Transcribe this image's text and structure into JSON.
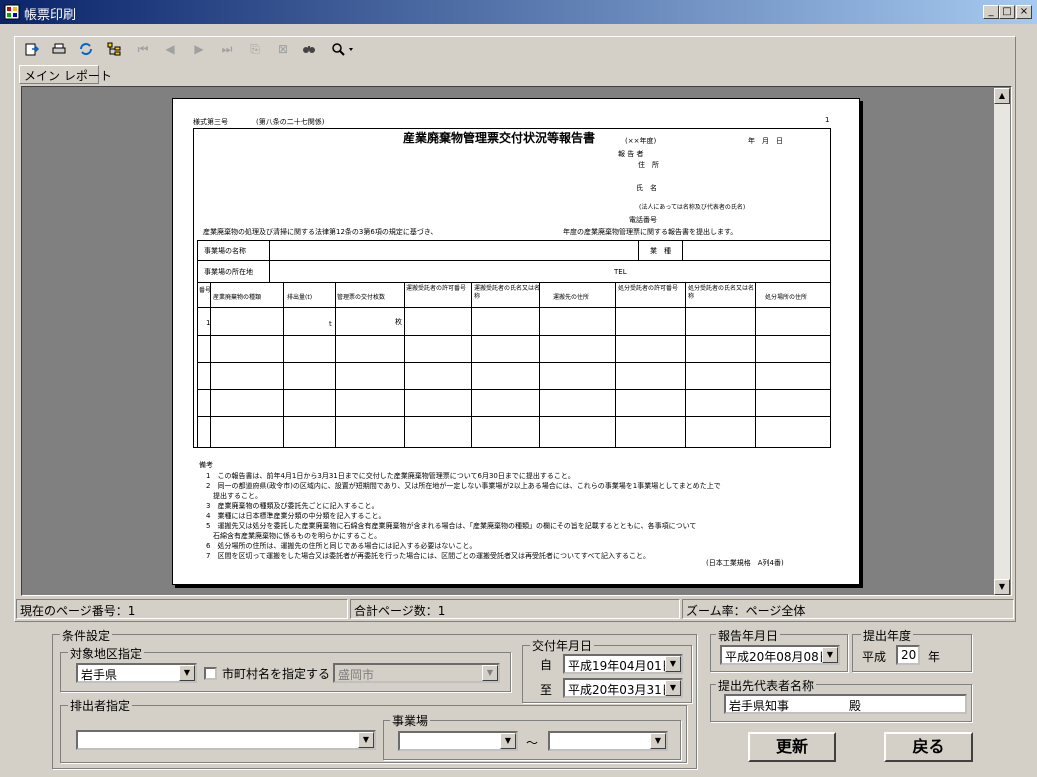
{
  "window": {
    "title": "帳票印刷",
    "min": "_",
    "max": "□",
    "close": "×"
  },
  "tab": {
    "label": "メイン レポート"
  },
  "report": {
    "form_no": "様式第三号",
    "law_ref": "(第八条の二十七関係)",
    "page_num": "1",
    "title": "産業廃棄物管理票交付状況等報告書",
    "era": "(××年度)",
    "date_line": "年　月　日",
    "reporter": "報 告 者",
    "address": "住　所",
    "name": "氏　名",
    "corp_note": "(法人にあっては名称及び代表者の氏名)",
    "phone_no": "電話番号",
    "intro_left": "産業廃棄物の処理及び清掃に関する法律第12条の3第6項の規定に基づき、",
    "intro_right": "年度の産業廃棄物管理票に関する報告書を提出します。",
    "row_site_name": "事業場の名称",
    "row_industry": "業　種",
    "row_site_addr": "事業場の所在地",
    "row_tel": "TEL",
    "col_headers": [
      "番号",
      "産業廃棄物の種類",
      "排出量(t)",
      "管理票の交付枚数",
      "運搬受託者の許可番号",
      "運搬受託者の氏名又は名称",
      "運搬先の住所",
      "処分受託者の許可番号",
      "処分受託者の氏名又は名称",
      "処分場所の住所"
    ],
    "row1_num": "1",
    "unit_t": "t",
    "unit_mai": "枚",
    "notes_title": "備考",
    "notes": [
      "1　この報告書は、前年4月1日から3月31日までに交付した産業廃棄物管理票について6月30日までに提出すること。",
      "2　同一の都道府県(政令市)の区域内に、設置が短期間であり、又は所在地が一定しない事業場が2以上ある場合には、これらの事業場を1事業場としてまとめた上で",
      "　提出すること。",
      "3　産業廃棄物の種類及び委託先ごとに記入すること。",
      "4　業種には日本標準産業分類の中分類を記入すること。",
      "5　運搬先又は処分を委託した産業廃棄物に石綿含有産業廃棄物が含まれる場合は、「産業廃棄物の種類」の欄にその旨を記載するとともに、各事項について",
      "　石綿含有産業廃棄物に係るものを明らかにすること。",
      "6　処分場所の住所は、運搬先の住所と同じである場合には記入する必要はないこと。",
      "7　区間を区切って運搬をした場合又は委託者が再委託を行った場合には、区間ごとの運搬受託者又は再受託者についてすべて記入すること。"
    ],
    "footer": "(日本工業規格　A列4番)"
  },
  "status": {
    "current_page": "現在のページ番号：1",
    "total_pages": "合計ページ数：1",
    "zoom": "ズーム率：ページ全体"
  },
  "conditions": {
    "group_label": "条件設定",
    "area_label": "対象地区指定",
    "pref_value": "岩手県",
    "city_check_label": "市町村名を指定する",
    "city_value": "盛岡市",
    "issue_label": "交付年月日",
    "from_label": "自",
    "from_value": "平成19年04月01日",
    "to_label": "至",
    "to_value": "平成20年03月31日",
    "emitter_label": "排出者指定",
    "emitter_value": "",
    "site_label": "事業場",
    "site_from": "",
    "tilde": "～",
    "site_to": ""
  },
  "report_date": {
    "label": "報告年月日",
    "value": "平成20年08月08日"
  },
  "fiscal": {
    "label": "提出年度",
    "era": "平成",
    "value": "20",
    "unit": "年"
  },
  "recipient": {
    "label": "提出先代表者名称",
    "value": "岩手県知事　　　　　殿"
  },
  "buttons": {
    "update": "更新",
    "back": "戻る"
  }
}
